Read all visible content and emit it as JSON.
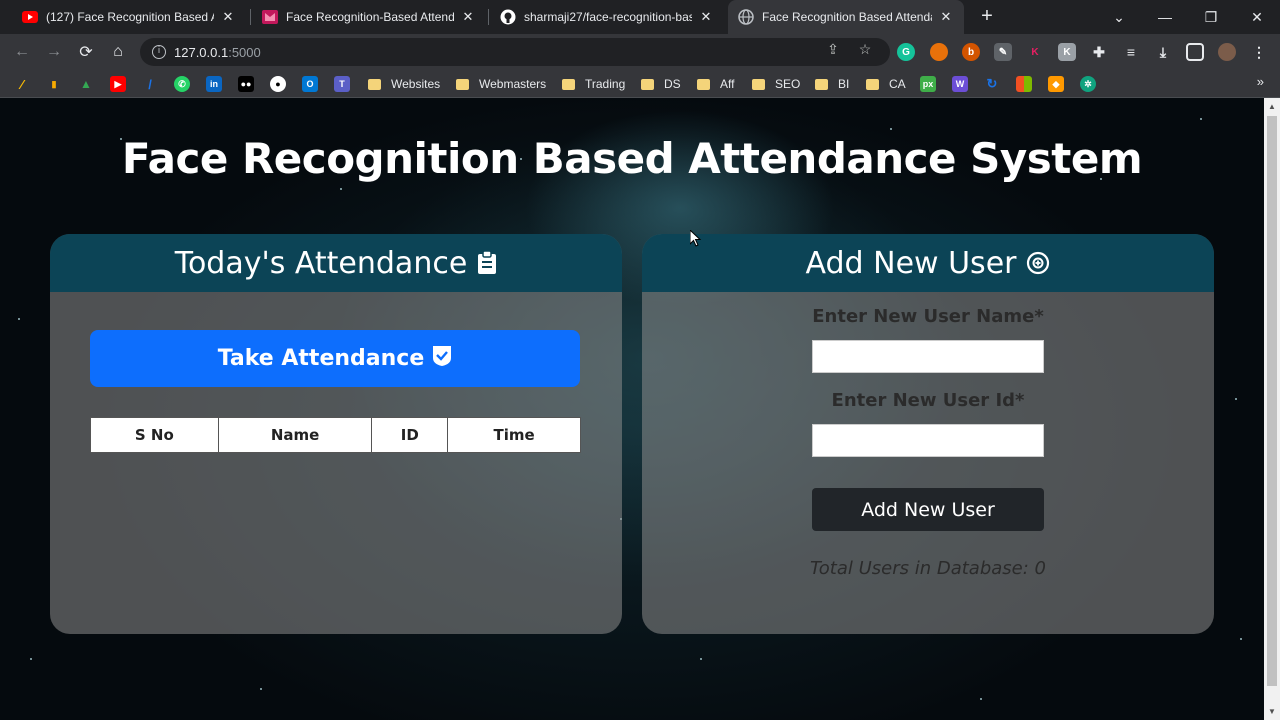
{
  "browser": {
    "tabs": [
      {
        "title": "(127) Face Recognition Based Att",
        "favicon": "youtube-icon"
      },
      {
        "title": "Face Recognition-Based Attendan",
        "favicon": "paper-icon"
      },
      {
        "title": "sharmaji27/face-recognition-base",
        "favicon": "github-icon"
      },
      {
        "title": "Face Recognition Based Attendan",
        "favicon": "globe-icon",
        "active": true
      }
    ],
    "url_host": "127.0.0.1",
    "url_port": ":5000",
    "bookmark_folders": [
      "Websites",
      "Webmasters",
      "Trading",
      "DS",
      "Aff",
      "SEO",
      "BI",
      "CA"
    ]
  },
  "page": {
    "title": "Face Recognition Based Attendance System",
    "attendance": {
      "heading": "Today's Attendance",
      "take_button": "Take Attendance",
      "columns": [
        "S No",
        "Name",
        "ID",
        "Time"
      ]
    },
    "add_user": {
      "heading": "Add New User",
      "name_label": "Enter New User Name*",
      "name_value": "",
      "id_label": "Enter New User Id*",
      "id_value": "",
      "button": "Add New User",
      "total_text": "Total Users in Database: 0"
    }
  },
  "colors": {
    "card_header": "#0c4456",
    "primary_button": "#0d6efd",
    "dark_button": "#212529"
  }
}
